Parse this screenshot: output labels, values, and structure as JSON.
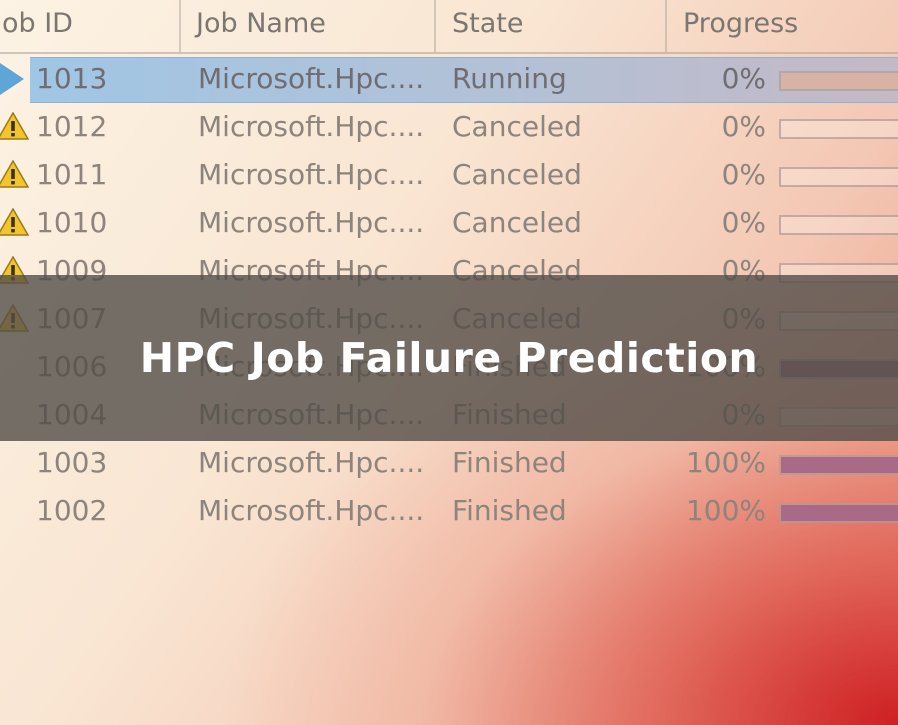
{
  "grid": {
    "columns": [
      {
        "key": "job_id",
        "label": "Job ID"
      },
      {
        "key": "job_name",
        "label": "Job Name"
      },
      {
        "key": "state",
        "label": "State"
      },
      {
        "key": "progress",
        "label": "Progress"
      }
    ],
    "rows": [
      {
        "status_icon": "play-icon",
        "job_id": "1013",
        "job_name": "Microsoft.Hpc....",
        "state": "Running",
        "progress": "0%",
        "progress_value": 0,
        "selected": true
      },
      {
        "status_icon": "warning-icon",
        "job_id": "1012",
        "job_name": "Microsoft.Hpc....",
        "state": "Canceled",
        "progress": "0%",
        "progress_value": 0
      },
      {
        "status_icon": "warning-icon",
        "job_id": "1011",
        "job_name": "Microsoft.Hpc....",
        "state": "Canceled",
        "progress": "0%",
        "progress_value": 0
      },
      {
        "status_icon": "warning-icon",
        "job_id": "1010",
        "job_name": "Microsoft.Hpc....",
        "state": "Canceled",
        "progress": "0%",
        "progress_value": 0
      },
      {
        "status_icon": "warning-icon",
        "job_id": "1009",
        "job_name": "Microsoft.Hpc....",
        "state": "Canceled",
        "progress": "0%",
        "progress_value": 0
      },
      {
        "status_icon": "warning-icon",
        "job_id": "1007",
        "job_name": "Microsoft.Hpc....",
        "state": "Canceled",
        "progress": "0%",
        "progress_value": 0
      },
      {
        "status_icon": "",
        "job_id": "1006",
        "job_name": "Microsoft.Hpc....",
        "state": "Finished",
        "progress": "100%",
        "progress_value": 100
      },
      {
        "status_icon": "",
        "job_id": "1004",
        "job_name": "Microsoft.Hpc....",
        "state": "Finished",
        "progress": "0%",
        "progress_value": 0
      },
      {
        "status_icon": "",
        "job_id": "1003",
        "job_name": "Microsoft.Hpc....",
        "state": "Finished",
        "progress": "100%",
        "progress_value": 100
      },
      {
        "status_icon": "",
        "job_id": "1002",
        "job_name": "Microsoft.Hpc....",
        "state": "Finished",
        "progress": "100%",
        "progress_value": 100
      }
    ]
  },
  "banner": {
    "title": "HPC Job Failure Prediction"
  },
  "colors": {
    "selection": "#a0c6e5",
    "play_icon": "#5ea5d8",
    "warning_fill": "#f2c530",
    "progress_fill": "#a86a86",
    "running_progress": "#d8b2a4"
  }
}
